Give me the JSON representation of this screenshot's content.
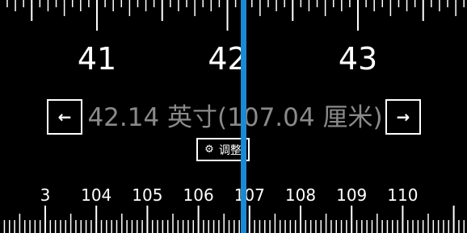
{
  "inch_labels": [
    "41",
    "42",
    "43"
  ],
  "cm_labels": [
    "3",
    "104",
    "105",
    "106",
    "107",
    "108",
    "109",
    "110"
  ],
  "reading": {
    "inches": "42.14",
    "inch_unit": "英寸",
    "cm": "107.04",
    "cm_unit": "厘米",
    "text": "42.14 英寸(107.04 厘米)"
  },
  "buttons": {
    "prev_glyph": "←",
    "next_glyph": "→",
    "adjust_label": "调整",
    "adjust_icon": "gear-icon"
  },
  "colors": {
    "background": "#000000",
    "ticks": "#ffffff",
    "reading_text": "#8a8a8a",
    "pointer": "#1a8ad4"
  }
}
